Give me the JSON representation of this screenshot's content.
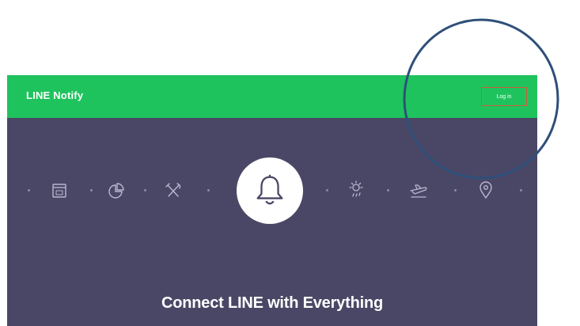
{
  "header": {
    "brand": "LINE Notify",
    "login_label": "Log in"
  },
  "hero": {
    "headline": "Connect LINE with Everything",
    "icons": [
      "calendar-icon",
      "pie-chart-icon",
      "utensils-icon",
      "bell-icon",
      "weather-icon",
      "plane-icon",
      "location-pin-icon"
    ]
  },
  "colors": {
    "header_green": "#1fc35d",
    "hero_bg": "#4a4766",
    "login_border": "#d05a3a",
    "annotation_circle": "#2f4f7a"
  }
}
